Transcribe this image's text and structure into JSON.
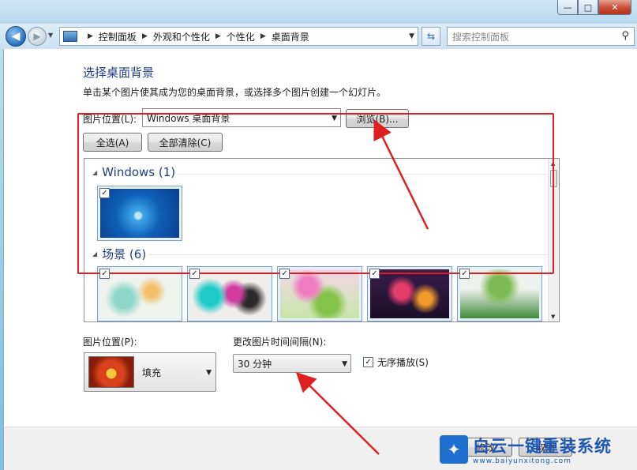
{
  "window": {
    "minimize_glyph": "—",
    "maximize_glyph": "□",
    "close_glyph": "✕"
  },
  "navbar": {
    "breadcrumbs": [
      "控制面板",
      "外观和个性化",
      "个性化",
      "桌面背景"
    ],
    "search_placeholder": "搜索控制面板"
  },
  "main": {
    "heading": "选择桌面背景",
    "subtext": "单击某个图片使其成为您的桌面背景，或选择多个图片创建一个幻灯片。",
    "location_label": "图片位置(L):",
    "location_value": "Windows 桌面背景",
    "browse_label": "浏览(B)...",
    "select_all_label": "全选(A)",
    "clear_all_label": "全部清除(C)"
  },
  "gallery": {
    "groups": [
      {
        "title": "Windows (1)",
        "checked": [
          true
        ]
      },
      {
        "title": "场景 (6)",
        "checked": [
          true,
          true,
          true,
          true,
          true
        ]
      }
    ]
  },
  "options": {
    "position_label": "图片位置(P):",
    "position_value": "填充",
    "interval_label": "更改图片时间间隔(N):",
    "interval_value": "30 分钟",
    "shuffle_label": "无序播放(S)",
    "shuffle_checked": true
  },
  "footer": {
    "save_label": "修改",
    "cancel_label": "取消"
  },
  "watermark": {
    "text": "白云一键重装系统",
    "url": "www.baiyunxitong.com"
  },
  "colors": {
    "annotation_red": "#e02020",
    "heading_blue": "#1e3f8a"
  }
}
